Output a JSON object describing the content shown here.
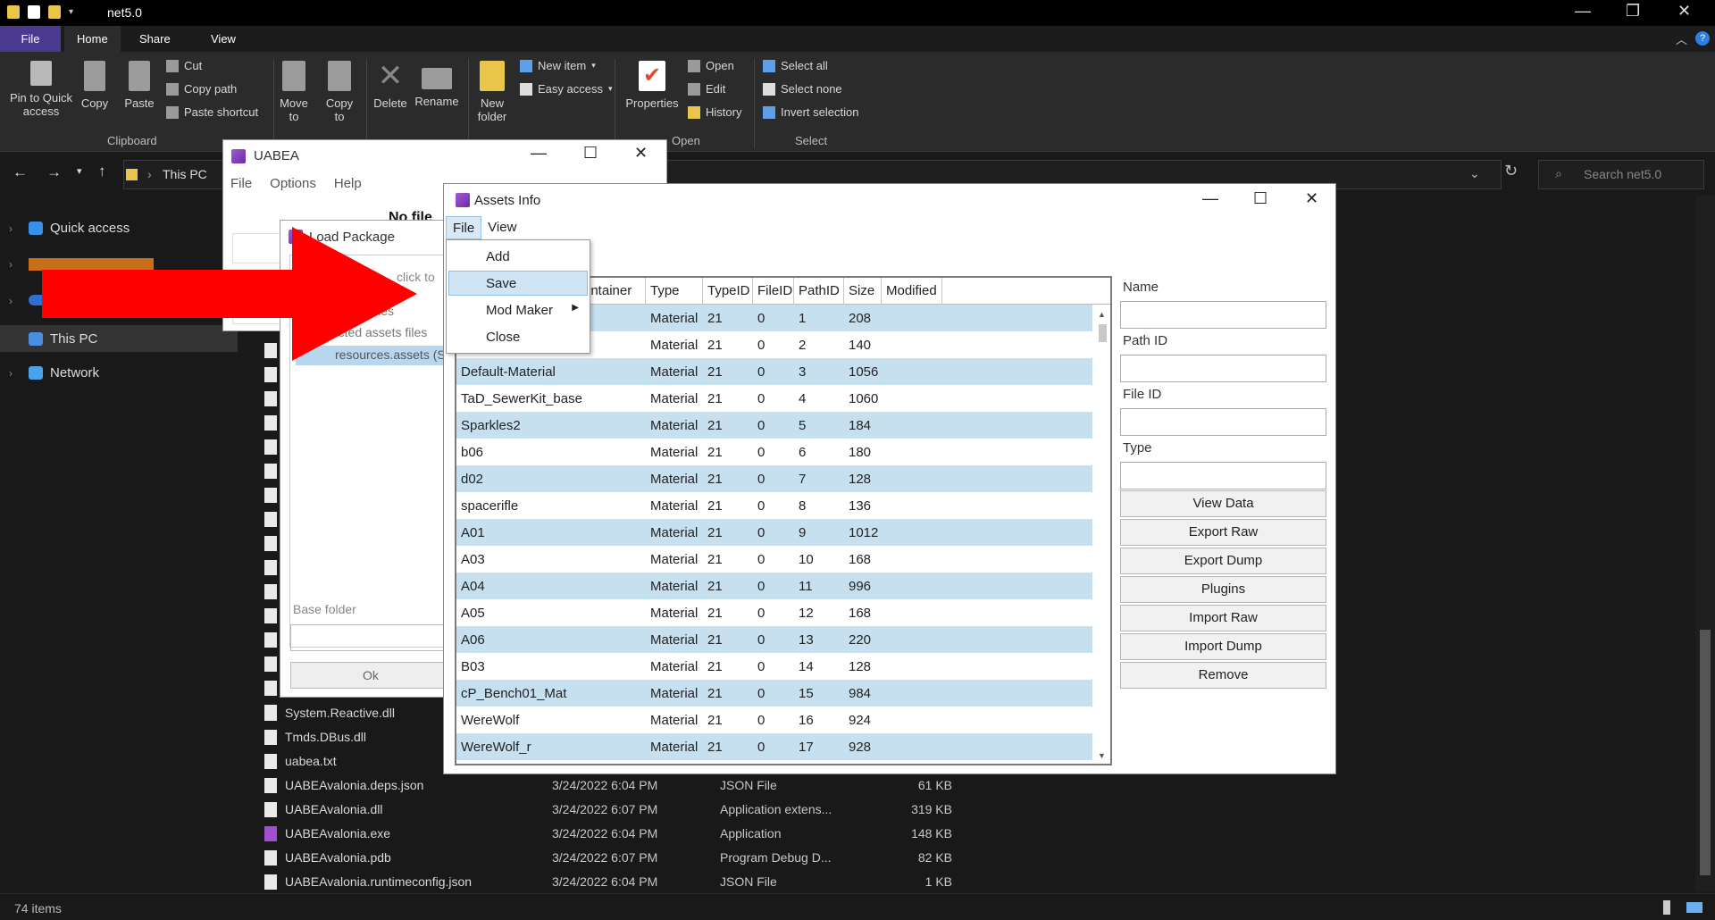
{
  "explorer": {
    "title": "net5.0",
    "tabs": [
      "File",
      "Home",
      "Share",
      "View"
    ],
    "ribbon": {
      "pin": "Pin to Quick access",
      "copy": "Copy",
      "paste": "Paste",
      "cut": "Cut",
      "copy_path": "Copy path",
      "paste_shortcut": "Paste shortcut",
      "clipboard": "Clipboard",
      "move_to": "Move to",
      "copy_to": "Copy to",
      "delete": "Delete",
      "rename": "Rename",
      "new_folder": "New folder",
      "new_item": "New item",
      "easy_access": "Easy access",
      "properties": "Properties",
      "open": "Open",
      "edit": "Edit",
      "history": "History",
      "open_group": "Open",
      "select_all": "Select all",
      "select_none": "Select none",
      "invert_selection": "Invert selection",
      "select_group": "Select"
    },
    "address": "This PC",
    "search_placeholder": "Search net5.0",
    "nav": [
      "Quick access",
      "This PC",
      "Network"
    ],
    "files": [
      {
        "name": "System.Reactive.dll",
        "date": "",
        "type": "",
        "size": ""
      },
      {
        "name": "Tmds.DBus.dll",
        "date": "",
        "type": "",
        "size": ""
      },
      {
        "name": "uabea.txt",
        "date": "",
        "type": "",
        "size": ""
      },
      {
        "name": "UABEAvalonia.deps.json",
        "date": "3/24/2022 6:04 PM",
        "type": "JSON File",
        "size": "61 KB"
      },
      {
        "name": "UABEAvalonia.dll",
        "date": "3/24/2022 6:07 PM",
        "type": "Application extens...",
        "size": "319 KB"
      },
      {
        "name": "UABEAvalonia.exe",
        "date": "3/24/2022 6:04 PM",
        "type": "Application",
        "size": "148 KB"
      },
      {
        "name": "UABEAvalonia.pdb",
        "date": "3/24/2022 6:07 PM",
        "type": "Program Debug D...",
        "size": "82 KB"
      },
      {
        "name": "UABEAvalonia.runtimeconfig.json",
        "date": "3/24/2022 6:04 PM",
        "type": "JSON File",
        "size": "1 KB"
      }
    ],
    "status": "74 items"
  },
  "uabea": {
    "title": "UABEA",
    "menu": [
      "File",
      "Options",
      "Help"
    ],
    "no_file": "No file"
  },
  "load_package": {
    "title": "Load Package",
    "click_to": "click to",
    "bundles": "bundles",
    "affected": "Affected assets files",
    "resources": "resources.assets (S",
    "base_folder": "Base folder",
    "ok": "Ok"
  },
  "assets_info": {
    "title": "Assets Info",
    "menu": [
      "File",
      "View"
    ],
    "columns": [
      "ontainer",
      "Type",
      "TypeID",
      "FileID",
      "PathID",
      "Size",
      "Modified"
    ],
    "rows": [
      {
        "name": "",
        "type": "Material",
        "typeid": "21",
        "fileid": "0",
        "pathid": "1",
        "size": "208"
      },
      {
        "name": "",
        "type": "Material",
        "typeid": "21",
        "fileid": "0",
        "pathid": "2",
        "size": "140"
      },
      {
        "name": "Default-Material",
        "type": "Material",
        "typeid": "21",
        "fileid": "0",
        "pathid": "3",
        "size": "1056"
      },
      {
        "name": "TaD_SewerKit_base",
        "type": "Material",
        "typeid": "21",
        "fileid": "0",
        "pathid": "4",
        "size": "1060"
      },
      {
        "name": "Sparkles2",
        "type": "Material",
        "typeid": "21",
        "fileid": "0",
        "pathid": "5",
        "size": "184"
      },
      {
        "name": "b06",
        "type": "Material",
        "typeid": "21",
        "fileid": "0",
        "pathid": "6",
        "size": "180"
      },
      {
        "name": "d02",
        "type": "Material",
        "typeid": "21",
        "fileid": "0",
        "pathid": "7",
        "size": "128"
      },
      {
        "name": "spacerifle",
        "type": "Material",
        "typeid": "21",
        "fileid": "0",
        "pathid": "8",
        "size": "136"
      },
      {
        "name": "A01",
        "type": "Material",
        "typeid": "21",
        "fileid": "0",
        "pathid": "9",
        "size": "1012"
      },
      {
        "name": "A03",
        "type": "Material",
        "typeid": "21",
        "fileid": "0",
        "pathid": "10",
        "size": "168"
      },
      {
        "name": "A04",
        "type": "Material",
        "typeid": "21",
        "fileid": "0",
        "pathid": "11",
        "size": "996"
      },
      {
        "name": "A05",
        "type": "Material",
        "typeid": "21",
        "fileid": "0",
        "pathid": "12",
        "size": "168"
      },
      {
        "name": "A06",
        "type": "Material",
        "typeid": "21",
        "fileid": "0",
        "pathid": "13",
        "size": "220"
      },
      {
        "name": "B03",
        "type": "Material",
        "typeid": "21",
        "fileid": "0",
        "pathid": "14",
        "size": "128"
      },
      {
        "name": "cP_Bench01_Mat",
        "type": "Material",
        "typeid": "21",
        "fileid": "0",
        "pathid": "15",
        "size": "984"
      },
      {
        "name": "WereWolf",
        "type": "Material",
        "typeid": "21",
        "fileid": "0",
        "pathid": "16",
        "size": "924"
      },
      {
        "name": "WereWolf_r",
        "type": "Material",
        "typeid": "21",
        "fileid": "0",
        "pathid": "17",
        "size": "928"
      }
    ],
    "side": {
      "name_label": "Name",
      "pathid_label": "Path ID",
      "fileid_label": "File ID",
      "type_label": "Type",
      "buttons": [
        "View Data",
        "Export Raw",
        "Export Dump",
        "Plugins",
        "Import Raw",
        "Import Dump",
        "Remove"
      ]
    },
    "file_menu": [
      "Add",
      "Save",
      "Mod Maker",
      "Close"
    ]
  },
  "colors": {
    "row_alt": "#c6e0f0",
    "arrow": "#ff0000",
    "file_tab": "#4a3a8f"
  }
}
